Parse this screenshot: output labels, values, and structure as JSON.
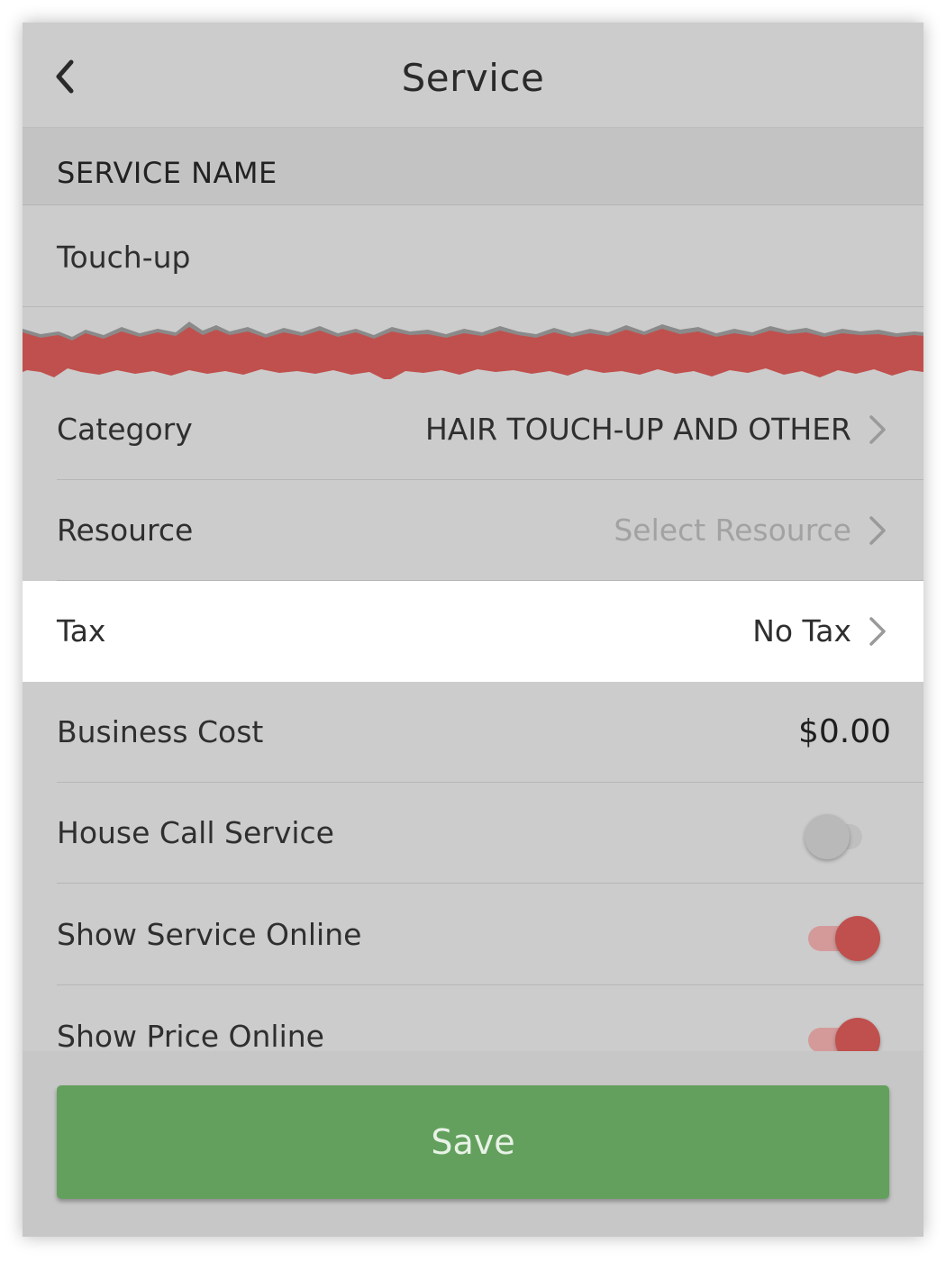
{
  "header": {
    "title": "Service",
    "back_icon": "chevron-left-icon"
  },
  "section": {
    "label": "SERVICE NAME"
  },
  "service_name": {
    "value": "Touch-up"
  },
  "rows": {
    "category": {
      "label": "Category",
      "value": "HAIR TOUCH-UP AND OTHER"
    },
    "resource": {
      "label": "Resource",
      "placeholder": "Select Resource"
    },
    "tax": {
      "label": "Tax",
      "value": "No Tax"
    },
    "business_cost": {
      "label": "Business Cost",
      "value": "$0.00"
    },
    "house_call": {
      "label": "House Call Service",
      "enabled": false
    },
    "show_service": {
      "label": "Show Service Online",
      "enabled": true
    },
    "show_price": {
      "label": "Show Price Online",
      "enabled": true
    }
  },
  "footer": {
    "save_label": "Save"
  },
  "colors": {
    "background": "#cccccc",
    "accent_red": "#c0504d",
    "save_green": "#63a05d",
    "highlight_row": "#ffffff"
  }
}
